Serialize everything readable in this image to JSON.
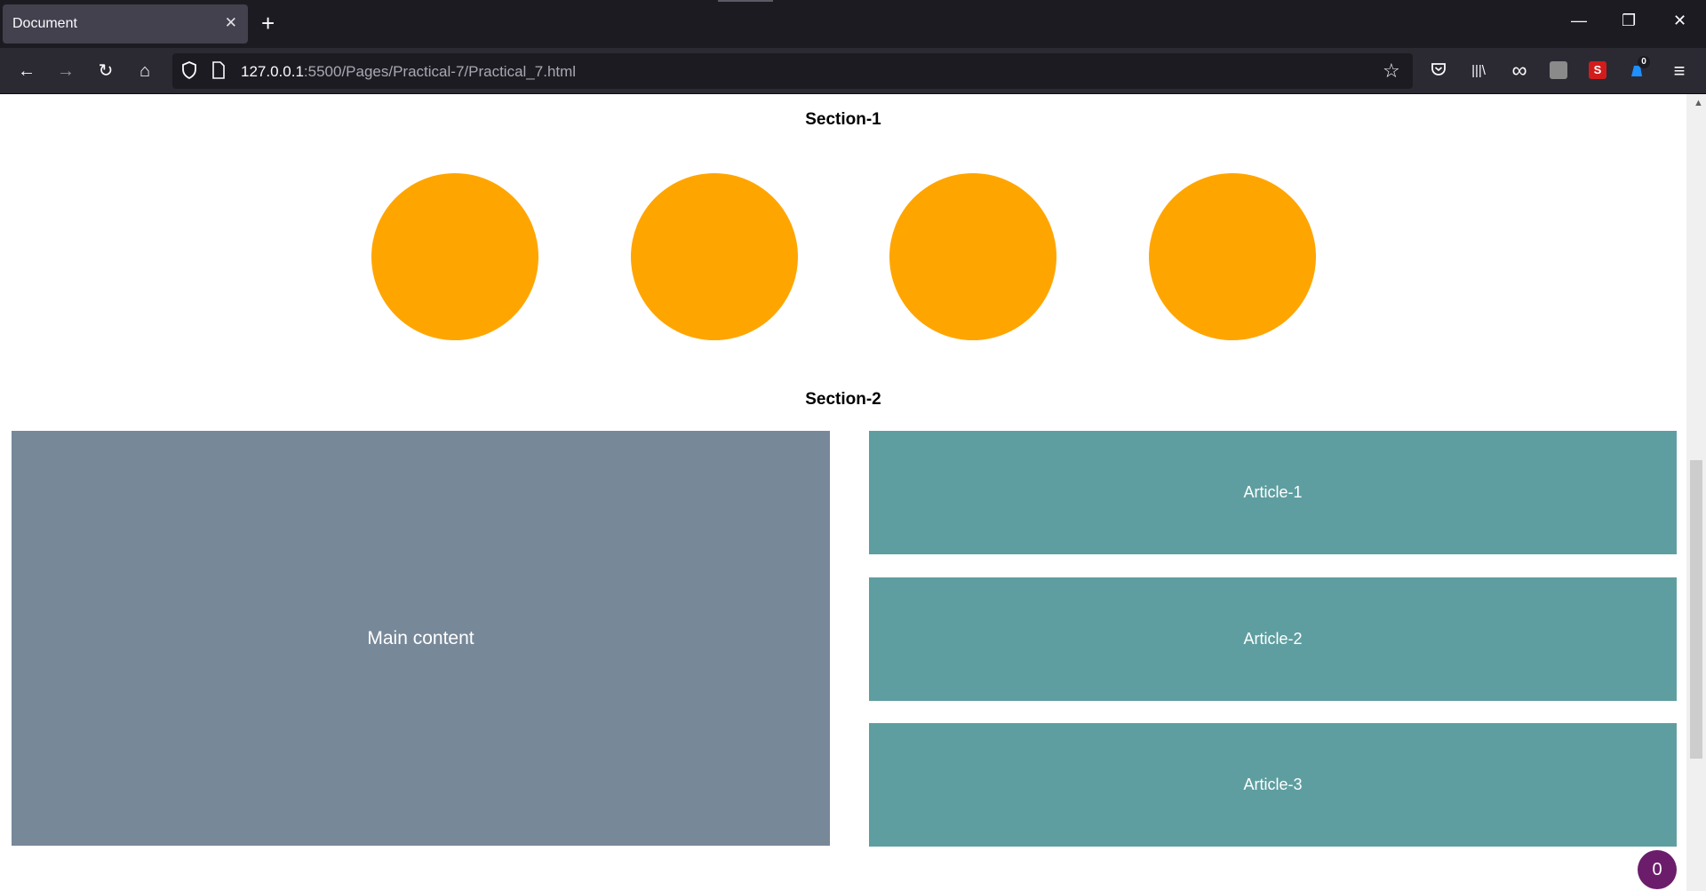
{
  "tab": {
    "title": "Document",
    "close_glyph": "✕",
    "new_tab_glyph": "+"
  },
  "window_controls": {
    "minimize": "—",
    "restore": "❐",
    "close": "✕"
  },
  "nav": {
    "back": "←",
    "forward": "→",
    "reload": "↻",
    "home": "⌂"
  },
  "address": {
    "host": "127.0.0.1",
    "rest": ":5500/Pages/Practical-7/Practical_7.html"
  },
  "toolbar": {
    "bookmark_star": "☆",
    "pocket": "◡",
    "library": "|||\\",
    "private": "∞",
    "menu": "≡",
    "ext_s": "S",
    "ext_badge": "0"
  },
  "page": {
    "section1_title": "Section-1",
    "section2_title": "Section-2",
    "main_content": "Main content",
    "articles": [
      "Article-1",
      "Article-2",
      "Article-3"
    ],
    "counter": "0"
  },
  "colors": {
    "circle": "#ffa500",
    "main": "#778899",
    "article": "#5f9ea0",
    "counter": "#6b1d6b"
  }
}
